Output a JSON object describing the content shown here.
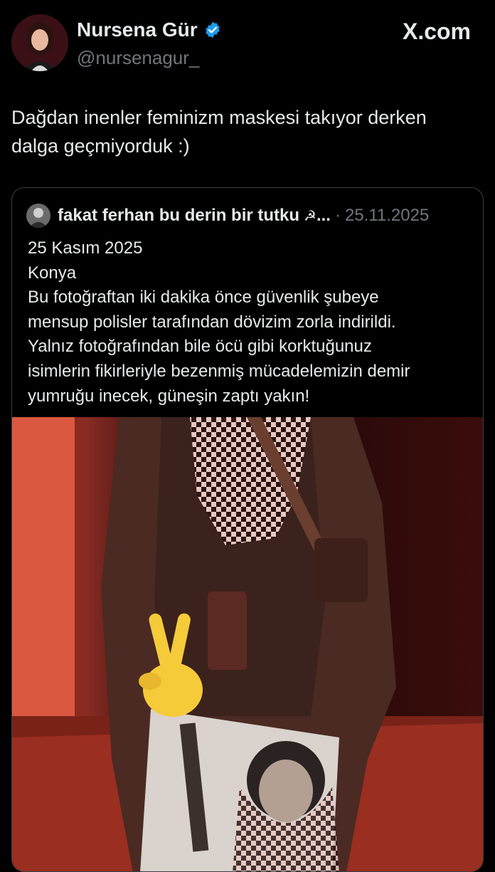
{
  "header": {
    "display_name": "Nursena Gür",
    "handle": "@nursenagur_",
    "brand": "X.com",
    "verified_icon": "verified-badge-icon",
    "accent": "#1d9bf0"
  },
  "tweet": {
    "text_lines": [
      "Dağdan inenler feminizm maskesi takıyor derken",
      "dalga geçmiyorduk :)"
    ]
  },
  "quote": {
    "author": "fakat ferhan bu derin bir tutku",
    "symbol": "☭",
    "ellipsis": "...",
    "separator": "·",
    "date": "25.11.2025",
    "body_lines": [
      "25 Kasım 2025",
      "Konya",
      "Bu fotoğraftan iki dakika önce güvenlik şubeye",
      "mensup polisler tarafından dövizim zorla indirildi.",
      "Yalnız fotoğrafından bile öcü gibi korktuğunuz",
      "isimlerin fikirleriyle bezenmiş mücadelemizin demir",
      "yumruğu inecek, güneşin zaptı yakın!"
    ],
    "photo_emoji": "✌"
  },
  "colors": {
    "background": "#000000",
    "text": "#e7e9ea",
    "muted": "#71767b",
    "border": "#3b3f44"
  }
}
